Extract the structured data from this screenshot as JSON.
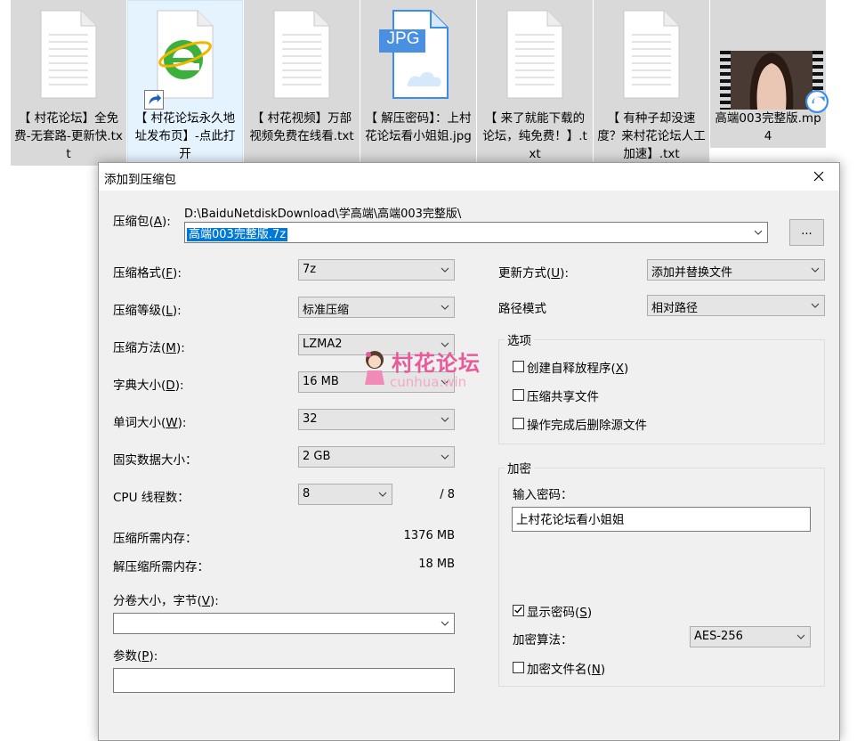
{
  "files": [
    {
      "name": "【 村花论坛】全免费-无套路-更新快.txt",
      "icon": "text-document-icon"
    },
    {
      "name": "【 村花论坛永久地址发布页】-点此打开",
      "icon": "ie-shortcut-icon"
    },
    {
      "name": "【 村花视频】万部视频免费在线看.txt",
      "icon": "text-document-icon"
    },
    {
      "name": "【 解压密码】：上村花论坛看小姐姐.jpg",
      "icon": "jpg-image-icon",
      "badge": "JPG"
    },
    {
      "name": "【 来了就能下载的论坛，纯免费！】.txt",
      "icon": "text-document-icon"
    },
    {
      "name": "【 有种子却没速度？来村花论坛人工加速】.txt",
      "icon": "text-document-icon"
    },
    {
      "name": "高端003完整版.mp4",
      "icon": "video-thumbnail-icon"
    }
  ],
  "dialog": {
    "title": "添加到压缩包",
    "archive": {
      "label": "压缩包(",
      "key": "A",
      "label_end": "):",
      "path": "D:\\BaiduNetdiskDownload\\学高端\\高端003完整版\\",
      "filename": "高端003完整版.7z",
      "browse": "..."
    },
    "format": {
      "label": "压缩格式(",
      "key": "F",
      "label_end": "):",
      "value": "7z"
    },
    "level": {
      "label": "压缩等级(",
      "key": "L",
      "label_end": "):",
      "value": "标准压缩"
    },
    "method": {
      "label": "压缩方法(",
      "key": "M",
      "label_end": "):",
      "value": "LZMA2"
    },
    "dict": {
      "label": "字典大小(",
      "key": "D",
      "label_end": "):",
      "value": "16 MB"
    },
    "word": {
      "label": "单词大小(",
      "key": "W",
      "label_end": "):",
      "value": "32"
    },
    "solid": {
      "label": "固实数据大小：",
      "value": "2 GB"
    },
    "threads": {
      "label": "CPU 线程数：",
      "value": "8",
      "max": "/ 8"
    },
    "mem_compress": {
      "label": "压缩所需内存：",
      "value": "1376 MB"
    },
    "mem_decompress": {
      "label": "解压缩所需内存：",
      "value": "18 MB"
    },
    "volume": {
      "label": "分卷大小，字节(",
      "key": "V",
      "label_end": "):",
      "value": ""
    },
    "params": {
      "label": "参数(",
      "key": "P",
      "label_end": "):",
      "value": ""
    },
    "update": {
      "label": "更新方式(",
      "key": "U",
      "label_end": "):",
      "value": "添加并替换文件"
    },
    "path_mode": {
      "label": "路径模式",
      "value": "相对路径"
    },
    "options": {
      "title": "选项",
      "sfx": {
        "label": "创建自释放程序(",
        "key": "X",
        "label_end": ")",
        "checked": false
      },
      "shared": {
        "label": "压缩共享文件",
        "checked": false
      },
      "delete": {
        "label": "操作完成后删除源文件",
        "checked": false
      }
    },
    "encryption": {
      "title": "加密",
      "password_label": "输入密码：",
      "password": "上村花论坛看小姐姐",
      "show": {
        "label": "显示密码(",
        "key": "S",
        "label_end": ")",
        "checked": true
      },
      "algo_label": "加密算法：",
      "algo": "AES-256",
      "encrypt_names": {
        "label": "加密文件名(",
        "key": "N",
        "label_end": ")",
        "checked": false
      }
    }
  },
  "watermark": {
    "text": "村花论坛",
    "sub": "cunhua.win"
  },
  "colors": {
    "selection": "#0078d7",
    "tile_selected": "#e5f3ff",
    "tile_dim": "#d9d9d9",
    "watermark_pink": "#e85b9a"
  }
}
